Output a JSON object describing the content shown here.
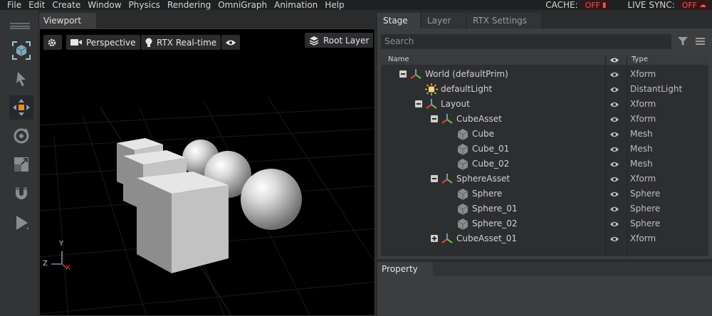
{
  "menubar": {
    "items": [
      "File",
      "Edit",
      "Create",
      "Window",
      "Physics",
      "Rendering",
      "OmniGraph",
      "Animation",
      "Help"
    ],
    "cache_label": "CACHE:",
    "cache_value": "OFF",
    "live_sync_label": "LIVE SYNC:",
    "live_sync_value": "OFF"
  },
  "toolbar": {
    "tools": [
      "select-mode-icon",
      "select-arrow-icon",
      "move-icon",
      "rotate-icon",
      "scale-icon",
      "snap-magnet-icon",
      "play-icon"
    ],
    "active_tool": "move-icon"
  },
  "viewport": {
    "tab_label": "Viewport",
    "camera_label": "Perspective",
    "render_label": "RTX Real-time",
    "layer_label": "Root Layer",
    "axes": {
      "x": "X",
      "y": "Y",
      "z": "Z"
    }
  },
  "stage": {
    "tabs": [
      "Stage",
      "Layer",
      "RTX Settings"
    ],
    "active_tab": "Stage",
    "search_placeholder": "Search",
    "columns": {
      "name": "Name",
      "type": "Type"
    },
    "rows": [
      {
        "name": "World (defaultPrim)",
        "type": "Xform",
        "depth": 0,
        "toggle": "minus",
        "icon": "xform"
      },
      {
        "name": "defaultLight",
        "type": "DistantLight",
        "depth": 1,
        "toggle": "",
        "icon": "light"
      },
      {
        "name": "Layout",
        "type": "Xform",
        "depth": 1,
        "toggle": "minus",
        "icon": "xform"
      },
      {
        "name": "CubeAsset",
        "type": "Xform",
        "depth": 2,
        "toggle": "minus",
        "icon": "xform"
      },
      {
        "name": "Cube",
        "type": "Mesh",
        "depth": 3,
        "toggle": "",
        "icon": "mesh"
      },
      {
        "name": "Cube_01",
        "type": "Mesh",
        "depth": 3,
        "toggle": "",
        "icon": "mesh"
      },
      {
        "name": "Cube_02",
        "type": "Mesh",
        "depth": 3,
        "toggle": "",
        "icon": "mesh"
      },
      {
        "name": "SphereAsset",
        "type": "Xform",
        "depth": 2,
        "toggle": "minus",
        "icon": "xform"
      },
      {
        "name": "Sphere",
        "type": "Sphere",
        "depth": 3,
        "toggle": "",
        "icon": "mesh"
      },
      {
        "name": "Sphere_01",
        "type": "Sphere",
        "depth": 3,
        "toggle": "",
        "icon": "mesh"
      },
      {
        "name": "Sphere_02",
        "type": "Sphere",
        "depth": 3,
        "toggle": "",
        "icon": "mesh"
      },
      {
        "name": "CubeAsset_01",
        "type": "Xform",
        "depth": 2,
        "toggle": "plus",
        "icon": "xform"
      }
    ]
  },
  "property": {
    "tab_label": "Property"
  },
  "colors": {
    "off_red": "#e45a5a",
    "accent_orange": "#f08a24"
  }
}
